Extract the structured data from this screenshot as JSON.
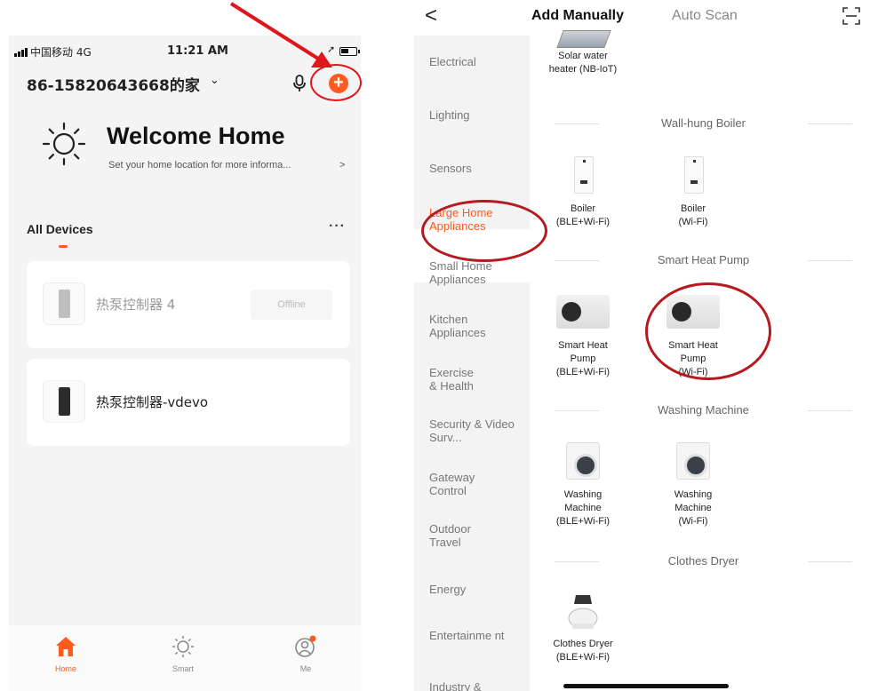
{
  "left": {
    "status": {
      "carrier": "中国移动 4G",
      "time": "11:21 AM"
    },
    "home_name": "86-15820643668的家",
    "welcome_title": "Welcome Home",
    "welcome_sub": "Set your home location for more informa...",
    "section_title": "All Devices",
    "devices": [
      {
        "name": "热泵控制器 4",
        "status": "Offline"
      },
      {
        "name": "热泵控制器-vdevo",
        "status": ""
      }
    ],
    "tabs": [
      {
        "label": "Home",
        "icon": "house-icon"
      },
      {
        "label": "Smart",
        "icon": "sun-icon"
      },
      {
        "label": "Me",
        "icon": "profile-icon"
      }
    ],
    "accent": "#ff5a1f"
  },
  "right": {
    "tabs": {
      "manual": "Add Manually",
      "auto": "Auto Scan"
    },
    "categories": [
      "Electrical",
      "Lighting",
      "Sensors",
      "Large Home Appliances",
      "Small Home Appliances",
      "Kitchen Appliances",
      "Exercise & Health",
      "Security & Video Surv...",
      "Gateway Control",
      "Outdoor Travel",
      "Energy",
      "Entertainme nt",
      "Industry &"
    ],
    "solar_label": "Solar water heater (NB-IoT)",
    "sections": [
      {
        "title": "Wall-hung Boiler",
        "items": [
          {
            "name": "Boiler",
            "conn": "(BLE+Wi-Fi)"
          },
          {
            "name": "Boiler",
            "conn": "(Wi-Fi)"
          }
        ]
      },
      {
        "title": "Smart Heat Pump",
        "items": [
          {
            "name": "Smart Heat Pump",
            "conn": "(BLE+Wi-Fi)"
          },
          {
            "name": "Smart Heat Pump",
            "conn": "(Wi-Fi)"
          }
        ]
      },
      {
        "title": "Washing Machine",
        "items": [
          {
            "name": "Washing Machine",
            "conn": "(BLE+Wi-Fi)"
          },
          {
            "name": "Washing Machine",
            "conn": "(Wi-Fi)"
          }
        ]
      },
      {
        "title": "Clothes Dryer",
        "items": [
          {
            "name": "Clothes Dryer",
            "conn": "(BLE+Wi-Fi)"
          }
        ]
      }
    ]
  },
  "annotation_color": "#e0161c"
}
